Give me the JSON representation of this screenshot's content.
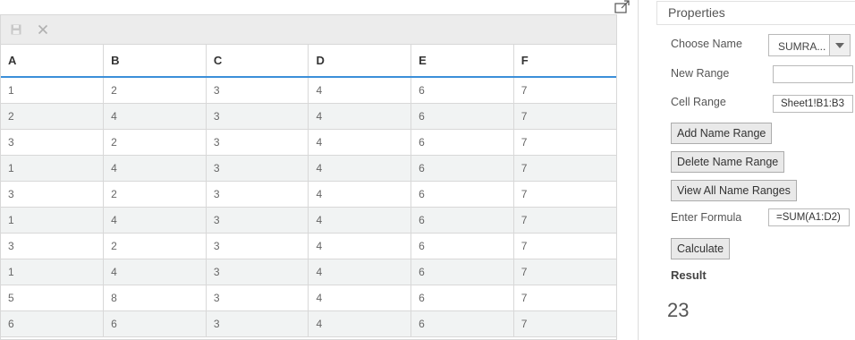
{
  "grid": {
    "toolbar": {
      "save_icon": "save-icon",
      "close_icon": "close-icon"
    },
    "columns": [
      "A",
      "B",
      "C",
      "D",
      "E",
      "F"
    ],
    "rows": [
      [
        "1",
        "2",
        "3",
        "4",
        "6",
        "7"
      ],
      [
        "2",
        "4",
        "3",
        "4",
        "6",
        "7"
      ],
      [
        "3",
        "2",
        "3",
        "4",
        "6",
        "7"
      ],
      [
        "1",
        "4",
        "3",
        "4",
        "6",
        "7"
      ],
      [
        "3",
        "2",
        "3",
        "4",
        "6",
        "7"
      ],
      [
        "1",
        "4",
        "3",
        "4",
        "6",
        "7"
      ],
      [
        "3",
        "2",
        "3",
        "4",
        "6",
        "7"
      ],
      [
        "1",
        "4",
        "3",
        "4",
        "6",
        "7"
      ],
      [
        "5",
        "8",
        "3",
        "4",
        "6",
        "7"
      ],
      [
        "6",
        "6",
        "3",
        "4",
        "6",
        "7"
      ]
    ],
    "header_accent": "#3b8fd9",
    "alt_row_bg": "#f1f3f3"
  },
  "properties": {
    "title": "Properties",
    "choose_name_label": "Choose Name",
    "choose_name_value": "SUMRA...",
    "new_range_label": "New Range",
    "new_range_value": "",
    "cell_range_label": "Cell Range",
    "cell_range_value": "Sheet1!B1:B3",
    "add_button": "Add Name Range",
    "delete_button": "Delete Name Range",
    "view_button": "View All Name Ranges",
    "formula_label": "Enter Formula",
    "formula_value": "=SUM(A1:D2)",
    "calculate_button": "Calculate",
    "result_label": "Result",
    "result_value": "23"
  }
}
